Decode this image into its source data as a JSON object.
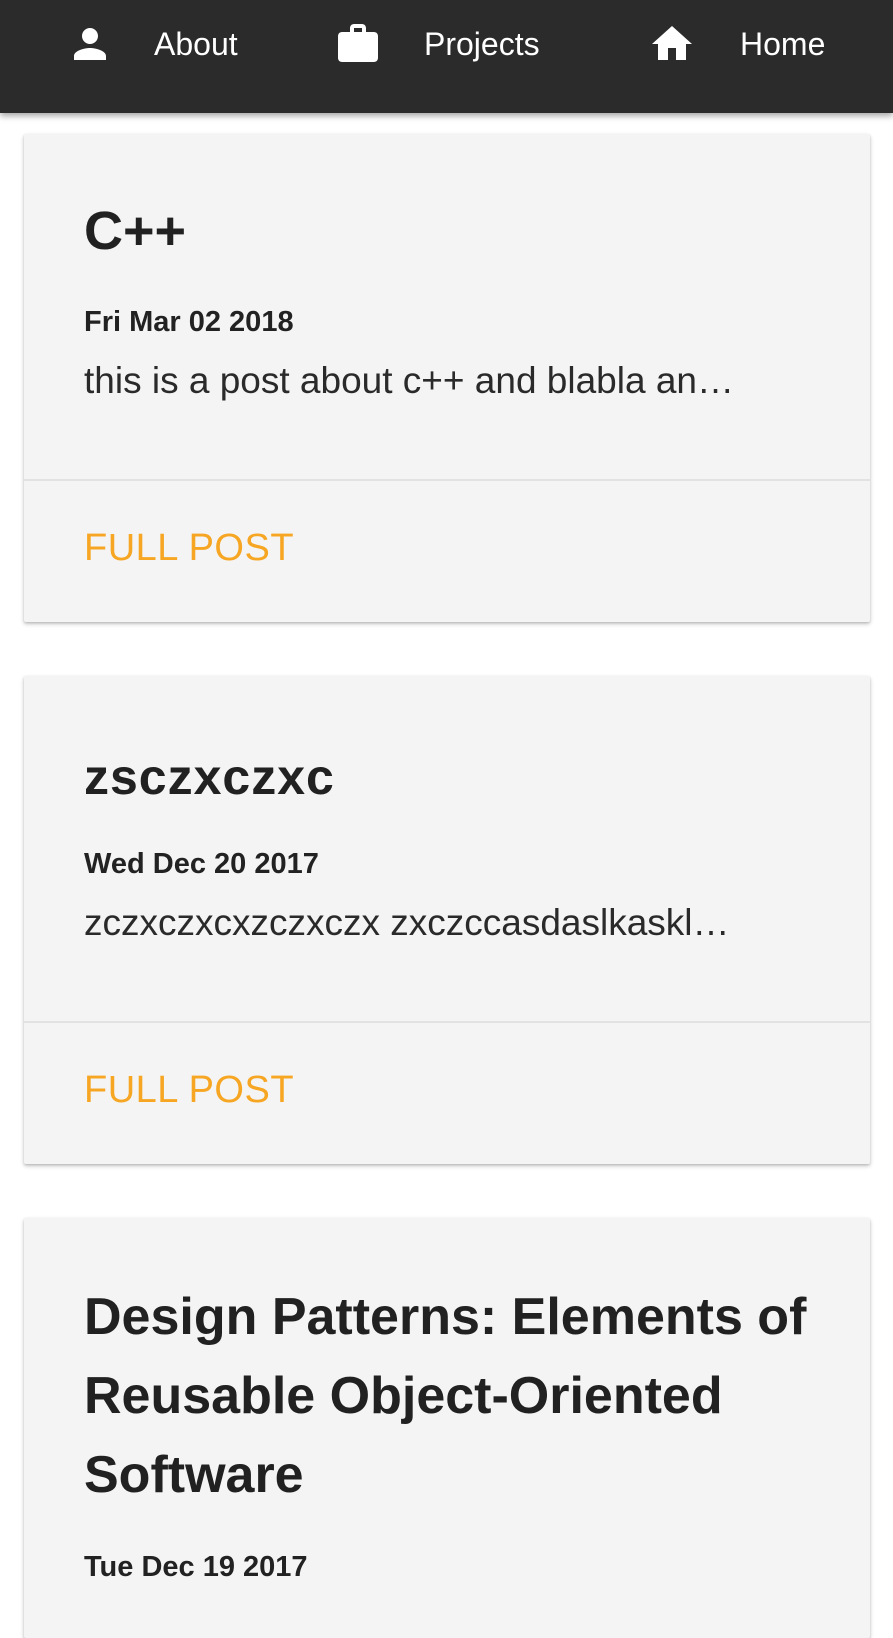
{
  "nav": {
    "items": [
      {
        "label": "About",
        "icon": "person-icon"
      },
      {
        "label": "Projects",
        "icon": "briefcase-icon"
      },
      {
        "label": "Home",
        "icon": "home-icon"
      }
    ]
  },
  "colors": {
    "navbar_bg": "#2b2b2b",
    "card_bg": "#f4f4f4",
    "accent": "#f6a623"
  },
  "posts": [
    {
      "title": "C++",
      "date": "Fri Mar 02 2018",
      "excerpt": "this is a post about c++ and blabla an…",
      "action": "FULL POST"
    },
    {
      "title": "zsczxczxc",
      "date": "Wed Dec 20 2017",
      "excerpt": "zczxczxcxzczxczx zxczccasdaslkaskl…",
      "action": "FULL POST"
    },
    {
      "title": "Design Patterns: Elements of Reusable Object-Oriented Software",
      "date": "Tue Dec 19 2017"
    }
  ]
}
